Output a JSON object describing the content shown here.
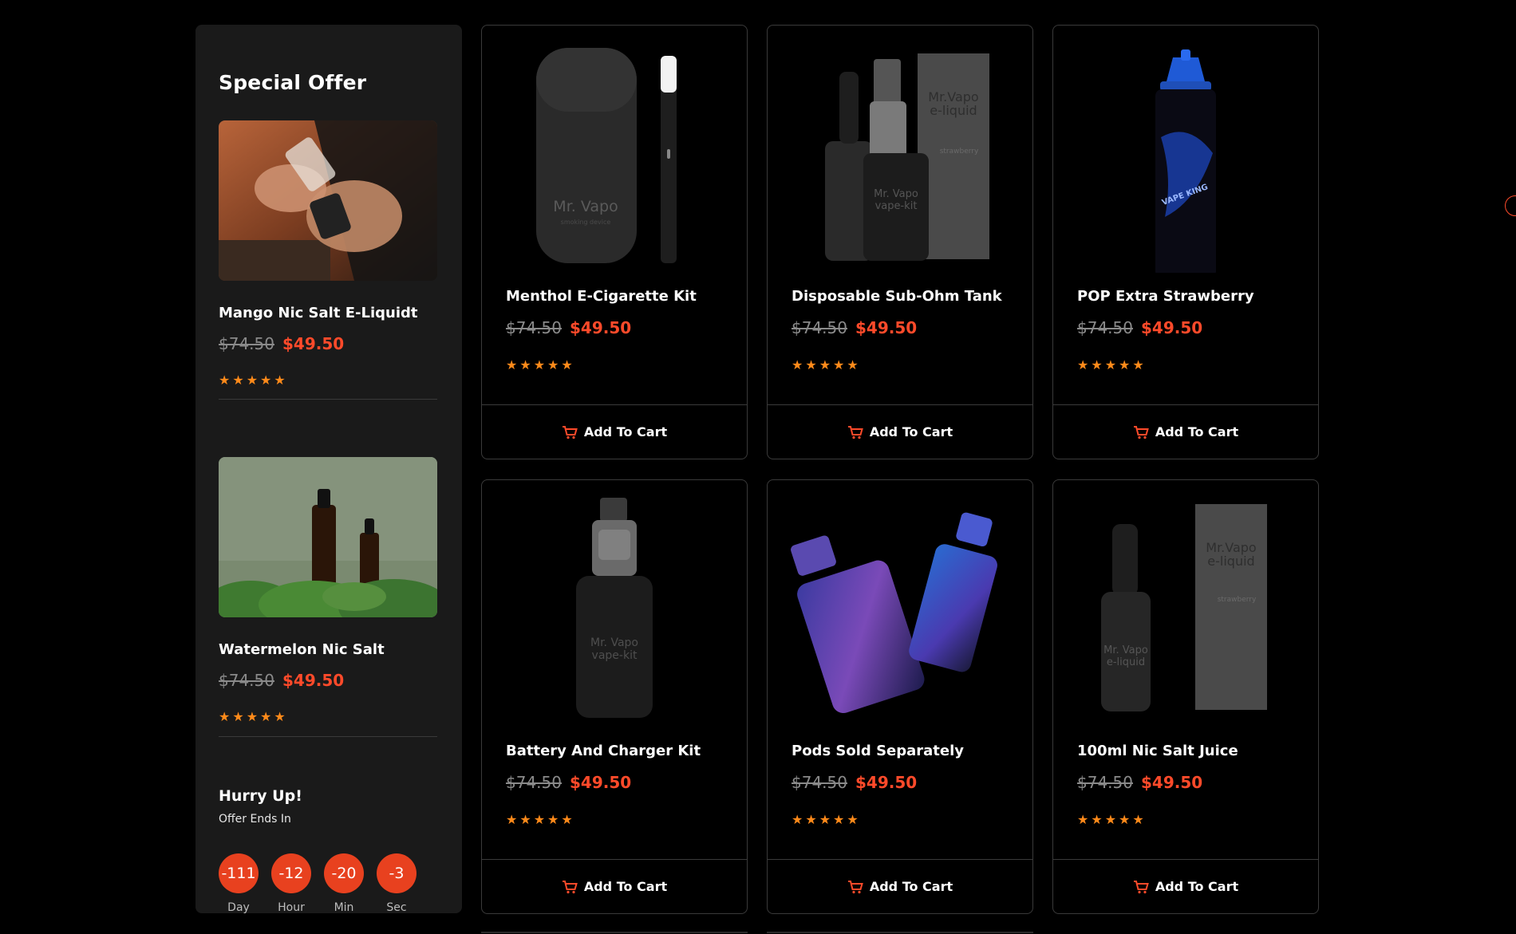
{
  "special_offer": {
    "title": "Special Offer",
    "items": [
      {
        "name": "Mango Nic Salt E-Liquidt",
        "old_price": "$74.50",
        "new_price": "$49.50",
        "rating": 5,
        "stars": "★★★★★"
      },
      {
        "name": "Watermelon Nic Salt",
        "old_price": "$74.50",
        "new_price": "$49.50",
        "rating": 5,
        "stars": "★★★★★"
      }
    ],
    "hurry_title": "Hurry Up!",
    "offer_ends": "Offer Ends In",
    "countdown": [
      {
        "value": "-111",
        "label": "Day"
      },
      {
        "value": "-12",
        "label": "Hour"
      },
      {
        "value": "-20",
        "label": "Min"
      },
      {
        "value": "-3",
        "label": "Sec"
      }
    ]
  },
  "products": [
    {
      "name": "Menthol E-Cigarette Kit",
      "old_price": "$74.50",
      "new_price": "$49.50",
      "rating": 5,
      "stars": "★★★★★",
      "cart_label": "Add To Cart",
      "img_text": [
        "Mr. Vapo",
        "smoking device"
      ]
    },
    {
      "name": "Disposable Sub-Ohm Tank",
      "old_price": "$74.50",
      "new_price": "$49.50",
      "rating": 5,
      "stars": "★★★★★",
      "cart_label": "Add To Cart",
      "img_text": [
        "Mr.Vapo",
        "e-liquid",
        "strawberry",
        "Mr. Vapo",
        "vape-kit"
      ]
    },
    {
      "name": "POP Extra Strawberry",
      "old_price": "$74.50",
      "new_price": "$49.50",
      "rating": 5,
      "stars": "★★★★★",
      "cart_label": "Add To Cart",
      "img_text": [
        "VAPE KING"
      ]
    },
    {
      "name": "Battery And Charger Kit",
      "old_price": "$74.50",
      "new_price": "$49.50",
      "rating": 5,
      "stars": "★★★★★",
      "cart_label": "Add To Cart",
      "img_text": [
        "Mr. Vapo",
        "vape-kit"
      ]
    },
    {
      "name": "Pods Sold Separately",
      "old_price": "$74.50",
      "new_price": "$49.50",
      "rating": 5,
      "stars": "★★★★★",
      "cart_label": "Add To Cart",
      "img_text": []
    },
    {
      "name": "100ml Nic Salt Juice",
      "old_price": "$74.50",
      "new_price": "$49.50",
      "rating": 5,
      "stars": "★★★★★",
      "cart_label": "Add To Cart",
      "img_text": [
        "Mr.Vapo",
        "e-liquid",
        "strawberry",
        "Mr. Vapo",
        "e-liquid"
      ]
    }
  ],
  "colors": {
    "accent": "#ff4a2a",
    "star": "#ff8a1a",
    "panel": "#1a1a1a",
    "border": "#3a3a3a"
  }
}
